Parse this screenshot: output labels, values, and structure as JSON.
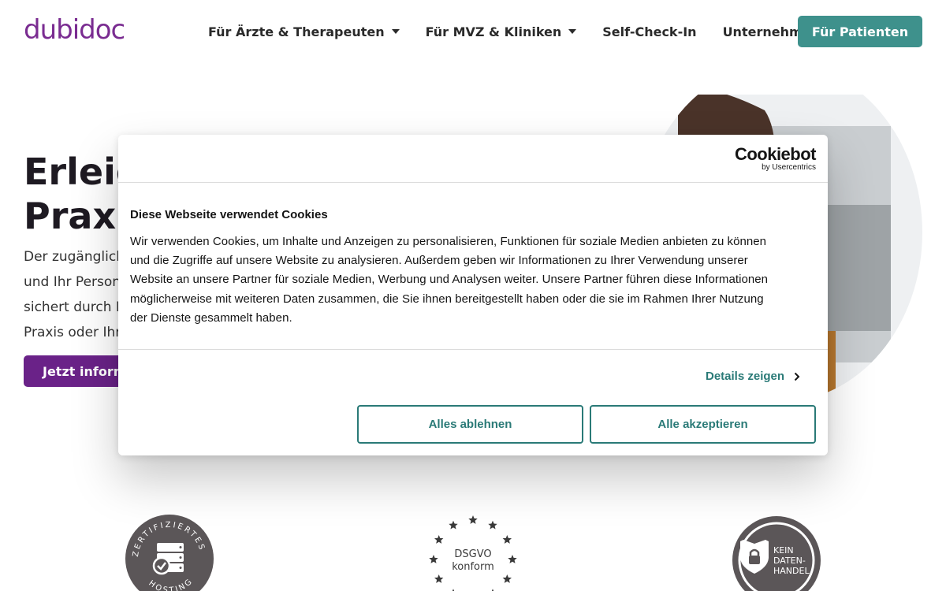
{
  "header": {
    "logo_text": "dubidoc",
    "nav": [
      {
        "label": "Für Ärzte & Therapeuten",
        "has_dropdown": true
      },
      {
        "label": "Für MVZ & Kliniken",
        "has_dropdown": true
      },
      {
        "label": "Self-Check-In",
        "has_dropdown": false
      },
      {
        "label": "Unternehmen",
        "has_dropdown": true
      }
    ],
    "cta_label": "Für Patienten"
  },
  "hero": {
    "title_line1": "Erleic",
    "title_line2": "Praxis",
    "text_lines": [
      "Der zugänglich",
      "und Ihr Person",
      "sichert durch P",
      "Praxis oder Ihr"
    ],
    "button_label": "Jetzt inform"
  },
  "badges": {
    "hosting": {
      "ring_text": "ZERTIFIZIERTES HOSTING"
    },
    "dsgvo": {
      "line1": "DSGVO",
      "line2": "konform"
    },
    "kein": {
      "line1": "KEIN",
      "line2": "DATEN-",
      "line3": "HANDEL"
    }
  },
  "cookie_dialog": {
    "brand": "Cookiebot",
    "brand_sub": "by Usercentrics",
    "title": "Diese Webseite verwendet Cookies",
    "text_lines": [
      "Wir verwenden Cookies, um Inhalte und Anzeigen zu personalisieren, Funktionen für soziale Medien anbieten zu können",
      "und die Zugriffe auf unsere Website zu analysieren. Außerdem geben wir Informationen zu Ihrer Verwendung unserer",
      "Website an unsere Partner für soziale Medien, Werbung und Analysen weiter. Unsere Partner führen diese Informationen",
      "möglicherweise mit weiteren Daten zusammen, die Sie ihnen bereitgestellt haben oder die sie im Rahmen Ihrer Nutzung",
      "der Dienste gesammelt haben."
    ],
    "details_label": "Details zeigen",
    "reject_label": "Alles ablehnen",
    "accept_label": "Alle akzeptieren"
  },
  "colors": {
    "brand_purple": "#6a2288",
    "teal": "#3e918c",
    "cookie_teal": "#2a7a77",
    "badge_gray": "#5b5658"
  }
}
